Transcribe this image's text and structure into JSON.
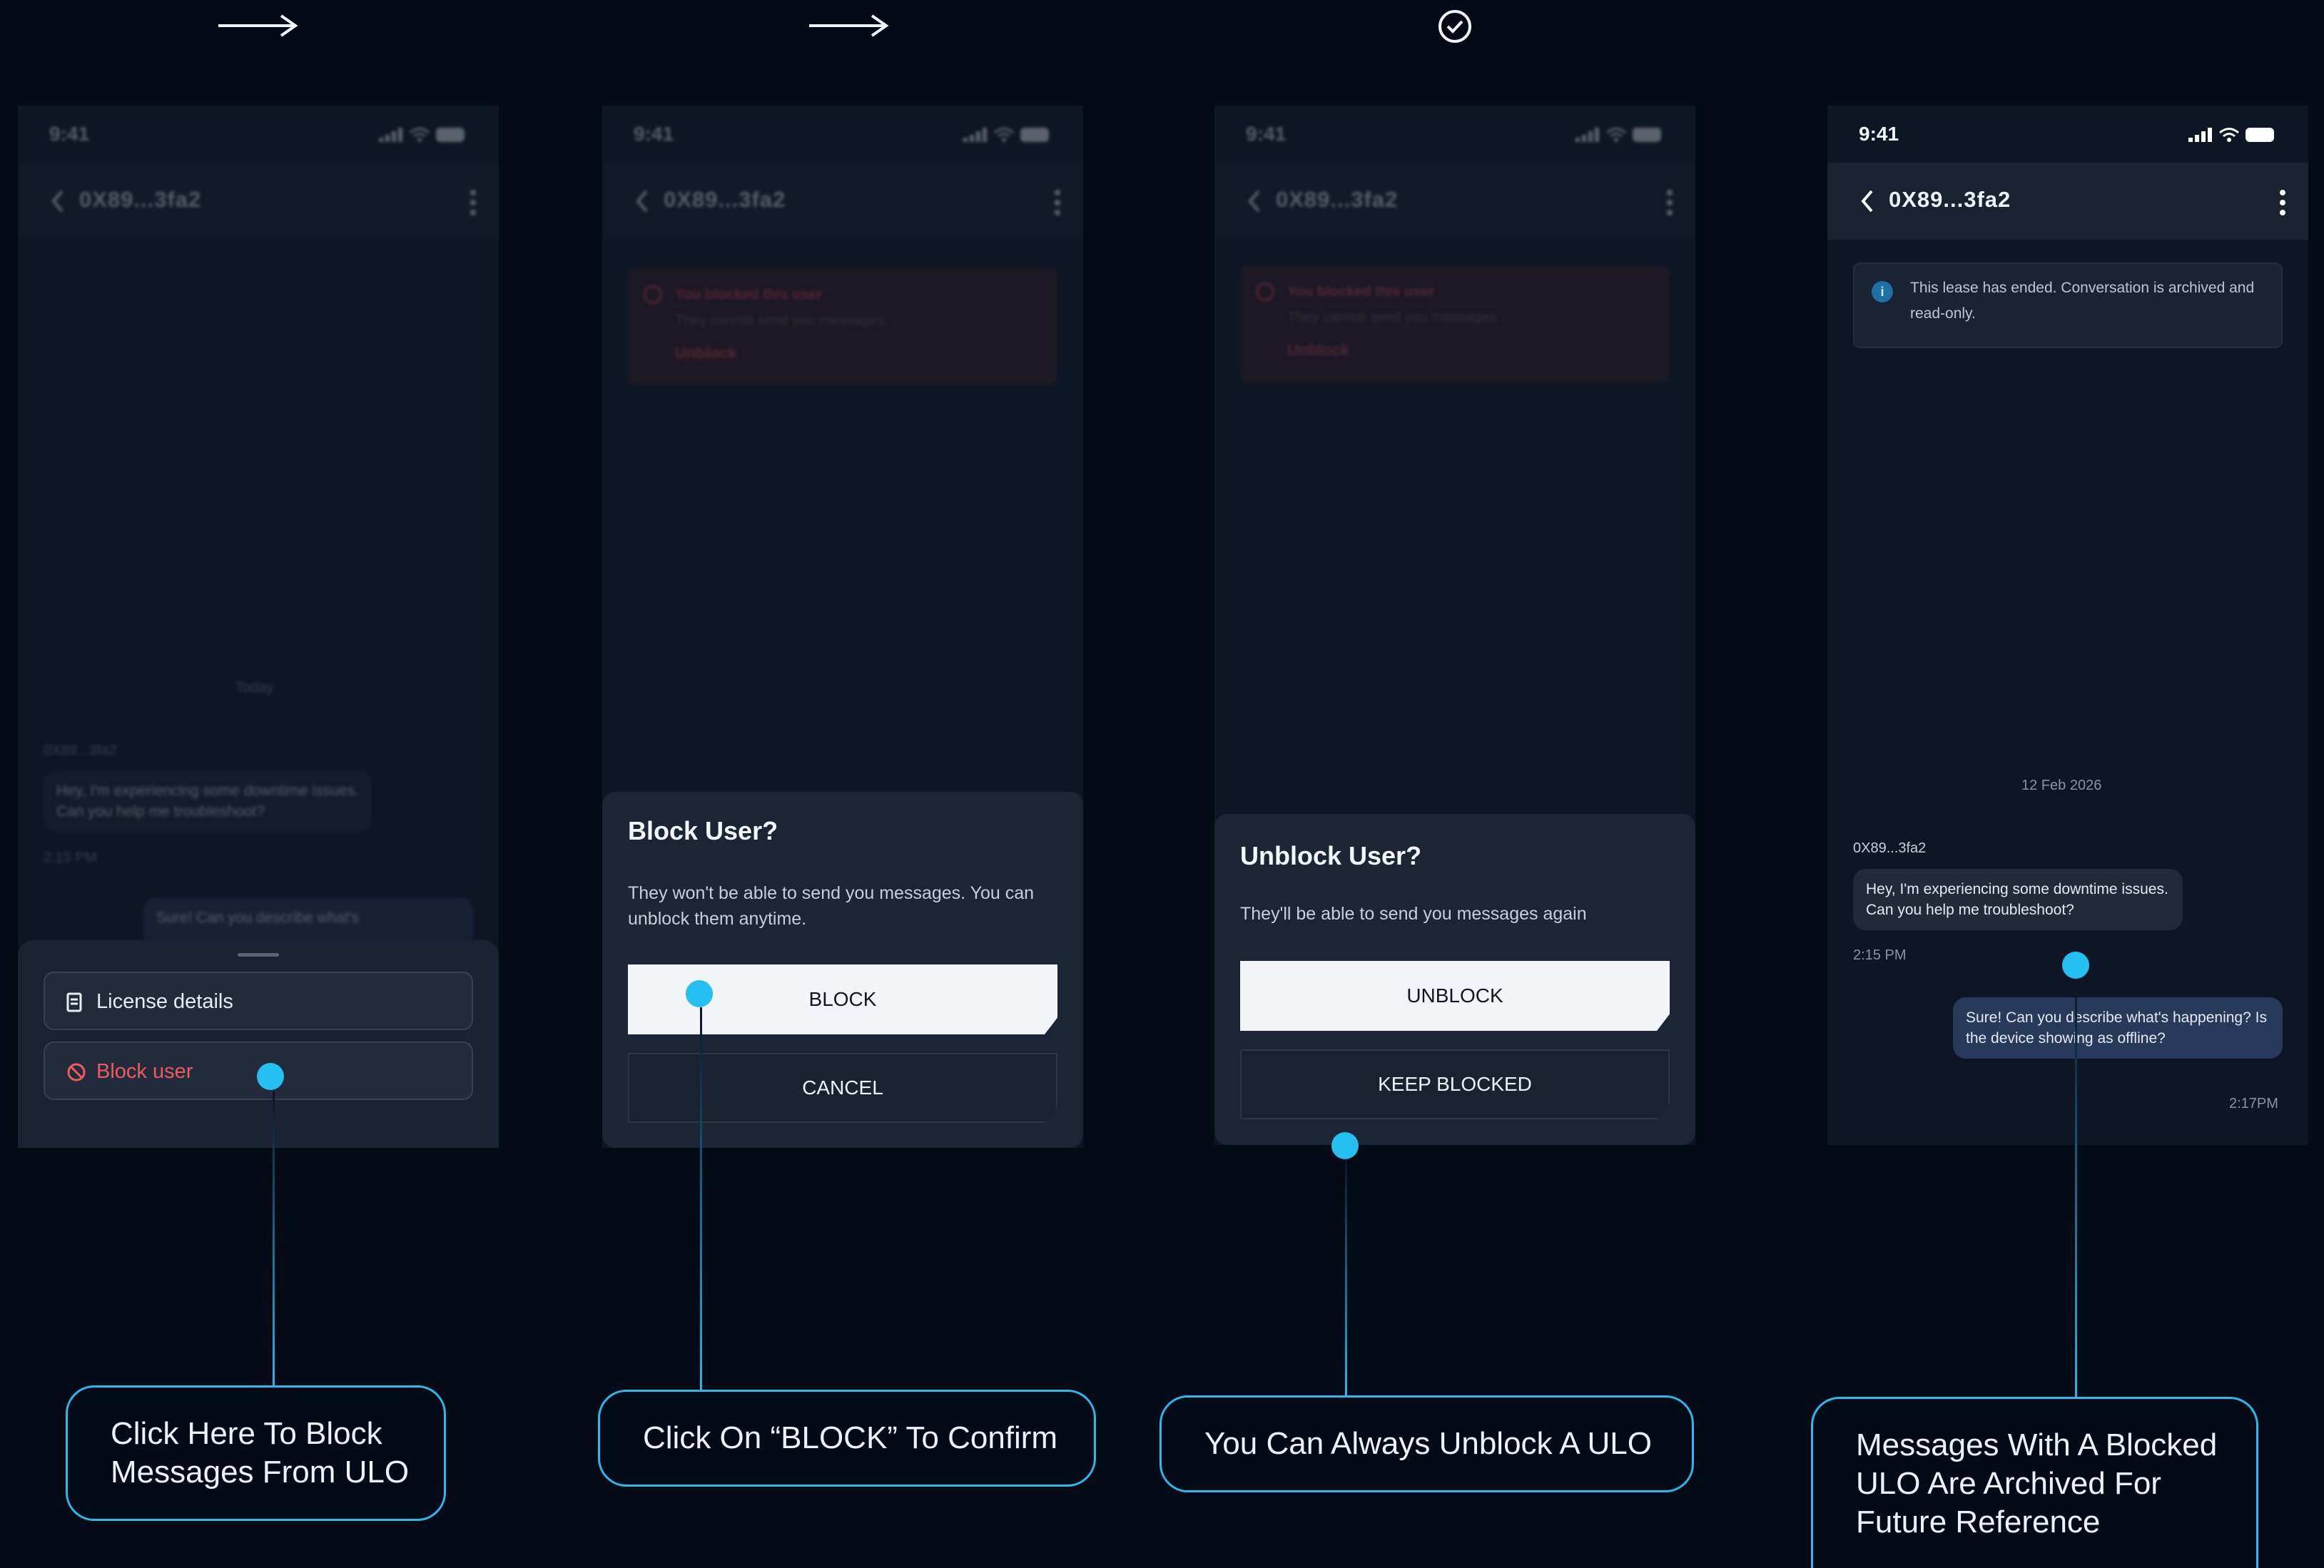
{
  "top_icons": [
    "arrow-right-icon",
    "arrow-right-icon",
    "check-circle-icon"
  ],
  "common": {
    "time": "9:41",
    "contact": "0X89...3fa2"
  },
  "screen1": {
    "date_divider": "Today",
    "sender": "0X89...3fa2",
    "incoming": "Hey, I'm experiencing some downtime issues. Can you help me troubleshoot?",
    "incoming_time": "2:15 PM",
    "outgoing_partial": "Sure! Can you describe what's",
    "menu": {
      "license": "License details",
      "block": "Block user"
    }
  },
  "blocked_banner": {
    "title": "You blocked this user",
    "subtitle": "They cannot send you messages.",
    "action": "Unblock"
  },
  "screen2": {
    "title": "Block User?",
    "text": "They won't be able to send you messages. You can unblock them anytime.",
    "primary": "BLOCK",
    "secondary": "CANCEL"
  },
  "screen3": {
    "title": "Unblock User?",
    "text": "They'll be able to send you messages again",
    "primary": "UNBLOCK",
    "secondary": "KEEP BLOCKED"
  },
  "screen4": {
    "info": "This lease has ended. Conversation is archived and read-only.",
    "date": "12 Feb 2026",
    "sender": "0X89...3fa2",
    "incoming": "Hey, I'm experiencing some downtime issues. Can you help me troubleshoot?",
    "incoming_time": "2:15 PM",
    "outgoing": "Sure! Can you describe what's happening? Is the device showing as offline?",
    "outgoing_time": "2:17PM"
  },
  "callouts": {
    "c1_line1": "Click Here To Block",
    "c1_line2": "Messages From ULO",
    "c2": "Click On “BLOCK” To Confirm",
    "c3": "You Can Always Unblock A ULO",
    "c4_line1": "Messages With A Blocked",
    "c4_line2": "ULO Are Archived For",
    "c4_line3": "Future Reference"
  },
  "colors": {
    "background": "#050a17",
    "accent": "#24c0f1",
    "danger": "#e0484a",
    "outgoing_bubble": "#273a5c"
  }
}
